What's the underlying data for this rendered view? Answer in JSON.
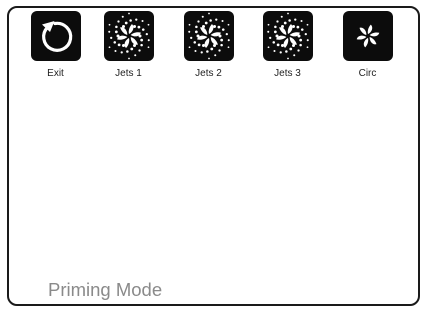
{
  "colors": {
    "tile_bg": "#0c0c0c",
    "icon_fg": "#ffffff",
    "label_text": "#222222",
    "mode_text": "#8a8a8a",
    "frame_border": "#1a1a1a"
  },
  "buttons": [
    {
      "label": "Exit",
      "icon": "back-arrow-icon"
    },
    {
      "label": "Jets 1",
      "icon": "jets-swirl-icon"
    },
    {
      "label": "Jets 2",
      "icon": "jets-swirl-icon"
    },
    {
      "label": "Jets 3",
      "icon": "jets-swirl-icon"
    },
    {
      "label": "Circ",
      "icon": "circulation-pump-icon"
    }
  ],
  "status": {
    "mode": "Priming Mode"
  }
}
